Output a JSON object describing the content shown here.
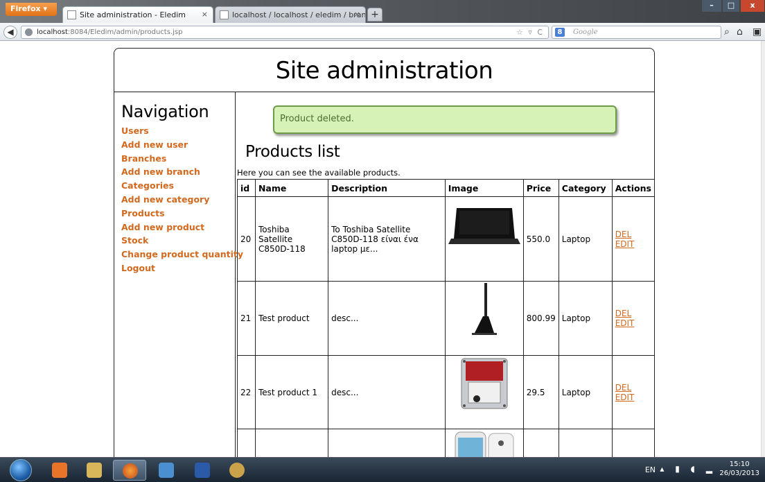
{
  "browser": {
    "menu_label": "Firefox ▾",
    "tabs": [
      {
        "label": "Site administration - Eledim",
        "close": "×"
      },
      {
        "label": "localhost / localhost / eledim / branc...",
        "close": "×"
      }
    ],
    "new_tab": "+",
    "url_host": "localhost",
    "url_path": ":8084/Eledim/admin/products.jsp",
    "search_engine": "8",
    "search_placeholder": "Google",
    "window_buttons": {
      "minimize": "–",
      "maximize": "□",
      "close": "x"
    }
  },
  "page": {
    "site_title": "Site administration",
    "nav_title": "Navigation",
    "nav_links": [
      "Users",
      "Add new user",
      "Branches",
      "Add new branch",
      "Categories",
      "Add new category",
      "Products",
      "Add new product",
      "Stock",
      "Change product quantity",
      "Logout"
    ],
    "message": "Product deleted.",
    "list_title": "Products list",
    "list_intro": "Here you can see the available products.",
    "table": {
      "headers": [
        "id",
        "Name",
        "Description",
        "Image",
        "Price",
        "Category",
        "Actions"
      ],
      "rows": [
        {
          "id": "20",
          "name": "Toshiba Satellite C850D-118",
          "description": "To Toshiba Satellite C850D-118 είναι ένα laptop με...",
          "price": "550.0",
          "category": "Laptop",
          "del": "DEL",
          "edit": "EDIT",
          "image": "laptop"
        },
        {
          "id": "21",
          "name": "Test product",
          "description": "desc...",
          "price": "800.99",
          "category": "Laptop",
          "del": "DEL",
          "edit": "EDIT",
          "image": "monitor"
        },
        {
          "id": "22",
          "name": "Test product 1",
          "description": "desc...",
          "price": "29.5",
          "category": "Laptop",
          "del": "DEL",
          "edit": "EDIT",
          "image": "hard-drive"
        }
      ]
    }
  },
  "taskbar": {
    "language": "EN",
    "time": "15:10",
    "date": "26/03/2013"
  },
  "colors": {
    "link": "#d2691e",
    "message_bg": "#d6f2b6",
    "message_border": "#6f9b48",
    "firefox_button": "#e8822c"
  }
}
